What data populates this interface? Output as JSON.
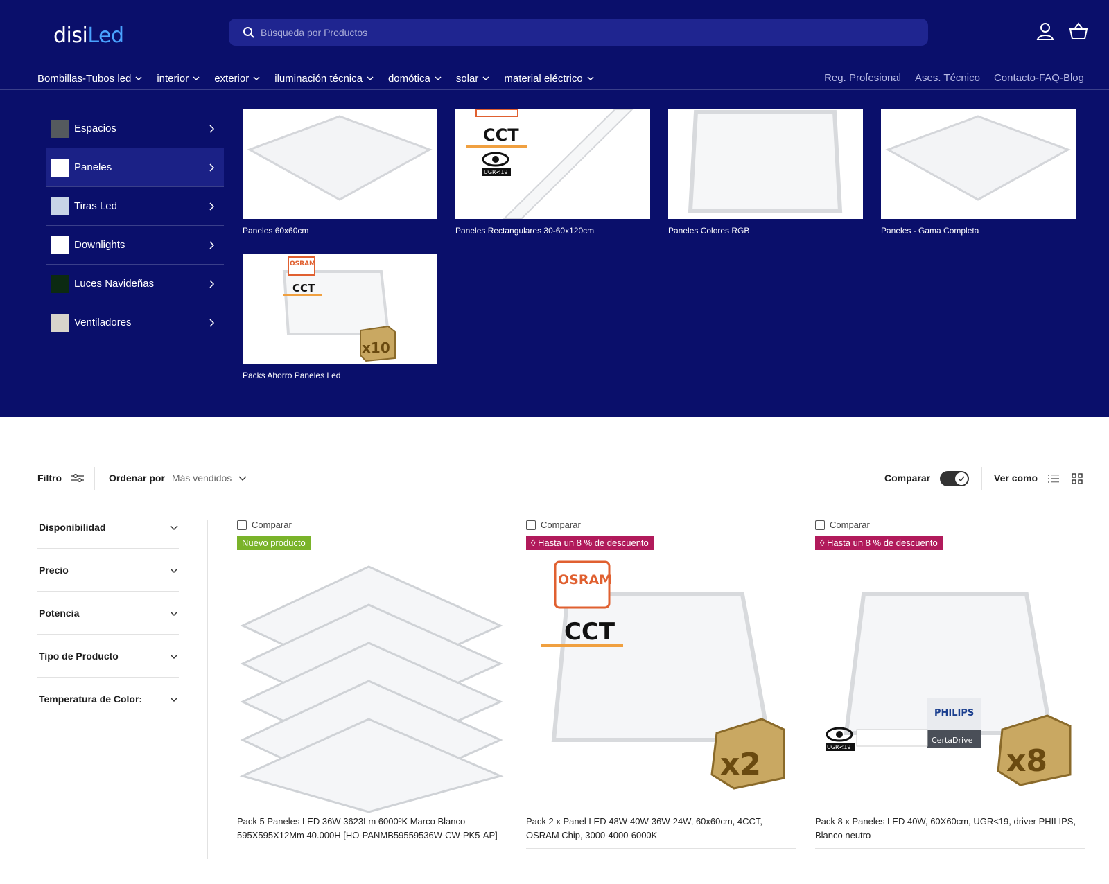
{
  "header": {
    "logo": {
      "part1": "disi",
      "part2": "Led"
    },
    "search_placeholder": "Búsqueda por Productos",
    "nav": [
      {
        "label": "Bombillas-Tubos led"
      },
      {
        "label": "interior"
      },
      {
        "label": "exterior"
      },
      {
        "label": "iluminación técnica"
      },
      {
        "label": "domótica"
      },
      {
        "label": "solar"
      },
      {
        "label": "material eléctrico"
      }
    ],
    "nav_right": [
      "Reg. Profesional",
      "Ases. Técnico",
      "Contacto-FAQ-Blog"
    ]
  },
  "mega_menu": {
    "categories": [
      {
        "label": "Espacios"
      },
      {
        "label": "Paneles"
      },
      {
        "label": "Tiras Led"
      },
      {
        "label": "Downlights"
      },
      {
        "label": "Luces Navideñas"
      },
      {
        "label": "Ventiladores"
      }
    ],
    "tiles": [
      {
        "caption": "Paneles 60x60cm"
      },
      {
        "caption": "Paneles Rectangulares 30-60x120cm"
      },
      {
        "caption": "Paneles Colores RGB"
      },
      {
        "caption": "Paneles - Gama Completa"
      },
      {
        "caption": "Packs Ahorro Paneles Led"
      }
    ],
    "image_text": {
      "cct": "CCT",
      "ugr": "UGR<19",
      "osram": "OSRAM",
      "pack_10": "x10"
    }
  },
  "toolbar": {
    "filter_label": "Filtro",
    "sort_label": "Ordenar por",
    "sort_value": "Más vendidos",
    "compare_label": "Comparar",
    "view_label": "Ver como"
  },
  "filters": [
    {
      "label": "Disponibilidad"
    },
    {
      "label": "Precio"
    },
    {
      "label": "Potencia"
    },
    {
      "label": "Tipo de Producto"
    },
    {
      "label": "Temperatura de Color:"
    }
  ],
  "products": [
    {
      "compare": "Comparar",
      "badge": "Nuevo producto",
      "title": "Pack 5 Paneles LED 36W 3623Lm 6000ºK Marco Blanco 595X595X12Mm 40.000H [HO-PANMB59559536W-CW-PK5-AP]"
    },
    {
      "compare": "Comparar",
      "badge": "Hasta un 8 % de descuento",
      "title": "Pack 2 x Panel LED 48W-40W-36W-24W, 60x60cm, 4CCT, OSRAM Chip, 3000-4000-6000K",
      "img_osram": "OSRAM",
      "img_cct": "CCT",
      "img_pack": "x2"
    },
    {
      "compare": "Comparar",
      "badge": "Hasta un 8 % de descuento",
      "title": "Pack 8 x Paneles LED 40W, 60X60cm, UGR<19, driver PHILIPS, Blanco neutro",
      "img_philips": "PHILIPS",
      "img_certadrive": "CertaDrive",
      "img_ugr": "UGR<19",
      "img_pack": "x8"
    }
  ],
  "colors": {
    "header_bg": "#0a0f6b",
    "accent": "#4aa3ff",
    "badge_new": "#7ab32a",
    "badge_discount": "#b11a5b"
  }
}
